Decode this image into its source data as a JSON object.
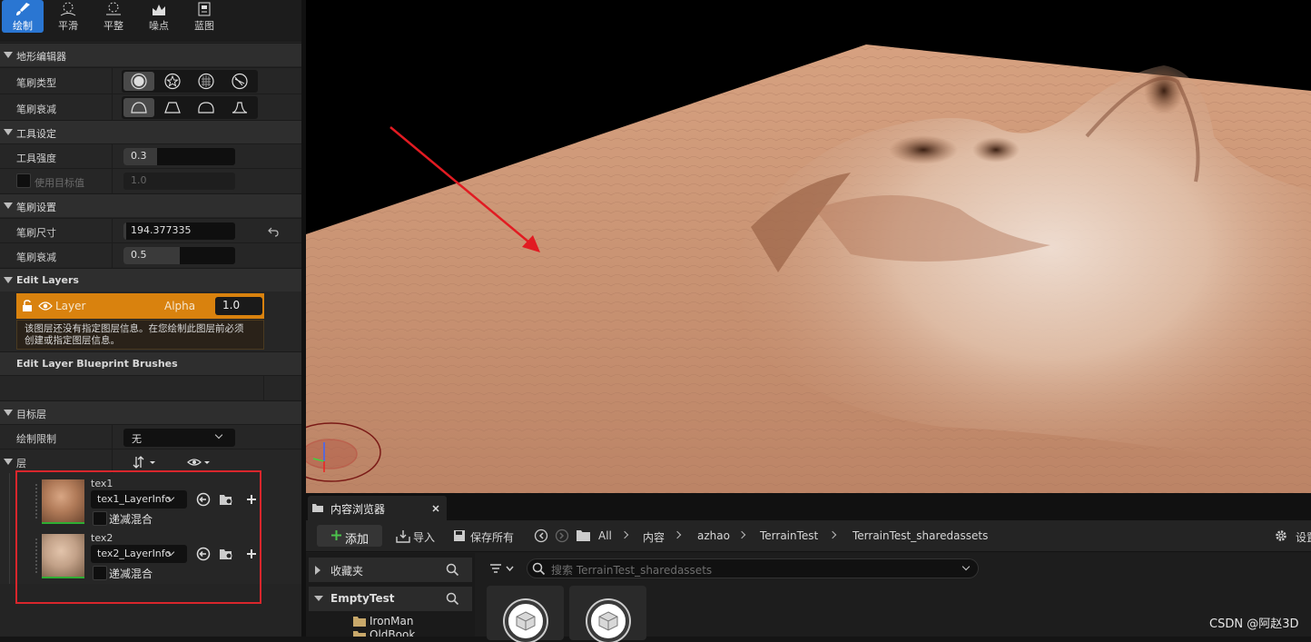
{
  "toolbar": {
    "tools": [
      {
        "label": "绘制",
        "icon": "brush-icon",
        "active": true
      },
      {
        "label": "平滑",
        "icon": "smooth-icon",
        "active": false
      },
      {
        "label": "平整",
        "icon": "flatten-icon",
        "active": false
      },
      {
        "label": "噪点",
        "icon": "noise-icon",
        "active": false
      },
      {
        "label": "蓝图",
        "icon": "blueprint-icon",
        "active": false
      }
    ]
  },
  "panel": {
    "terrain_editor": "地形编辑器",
    "brush_type_label": "笔刷类型",
    "brush_falloff_label": "笔刷衰减",
    "tool_settings": "工具设定",
    "tool_strength_label": "工具强度",
    "tool_strength_value": "0.3",
    "tool_strength_fraction": 0.3,
    "use_target_label": "使用目标值",
    "use_target_value": "1.0",
    "brush_settings": "笔刷设置",
    "brush_size_label": "笔刷尺寸",
    "brush_size_value": "194.377335",
    "brush_falloff2_label": "笔刷衰减",
    "brush_falloff2_value": "0.5",
    "brush_falloff2_fraction": 0.5,
    "edit_layers": "Edit Layers",
    "layer_name": "Layer",
    "alpha_label": "Alpha",
    "alpha_value": "1.0",
    "layer_note_line1": "该图层还没有指定图层信息。在您绘制此图层前必须",
    "layer_note_line2": "创建或指定图层信息。",
    "edit_layer_bp_brushes": "Edit Layer Blueprint Brushes",
    "target_layers": "目标层",
    "paint_limit_label": "绘制限制",
    "paint_limit_value": "无",
    "layers_label": "层"
  },
  "layers": [
    {
      "name": "tex1",
      "info": "tex1_LayerInfo",
      "blend_label": "递减混合"
    },
    {
      "name": "tex2",
      "info": "tex2_LayerInfo",
      "blend_label": "递减混合"
    }
  ],
  "content_browser": {
    "tab_title": "内容浏览器",
    "add_label": "添加",
    "import_label": "导入",
    "save_all_label": "保存所有",
    "breadcrumb": [
      "All",
      "内容",
      "azhao",
      "TerrainTest",
      "TerrainTest_sharedassets"
    ],
    "settings_label": "设置",
    "favorites_label": "收藏夹",
    "project_label": "EmptyTest",
    "folders": [
      "IronMan",
      "OldBook"
    ],
    "search_placeholder": "搜索 TerrainTest_sharedassets"
  },
  "watermark": "CSDN @阿赵3D",
  "colors": {
    "accent_blue": "#2a76d2",
    "layer_orange": "#d9820e",
    "highlight_red": "#d9262c",
    "terrain": "#c99474"
  }
}
